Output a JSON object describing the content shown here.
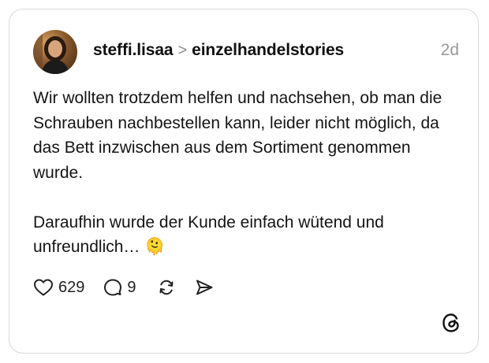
{
  "post": {
    "author": "steffi.lisaa",
    "reply_to": "einzelhandelstories",
    "separator": ">",
    "time": "2d",
    "paragraph1": "Wir wollten trotzdem helfen und nachsehen, ob man die Schrauben nachbestellen kann, leider nicht möglich, da das Bett inzwischen aus dem Sortiment genommen wurde.",
    "paragraph2": "Daraufhin wurde der Kunde einfach wütend und unfreundlich… 🫠"
  },
  "actions": {
    "likes": "629",
    "replies": "9"
  },
  "icons": {
    "like": "heart-icon",
    "reply": "comment-icon",
    "repost": "repost-icon",
    "share": "send-icon",
    "brand": "threads-logo-icon"
  },
  "colors": {
    "text": "#101010",
    "muted": "#999999",
    "border": "#d9d9d9"
  }
}
